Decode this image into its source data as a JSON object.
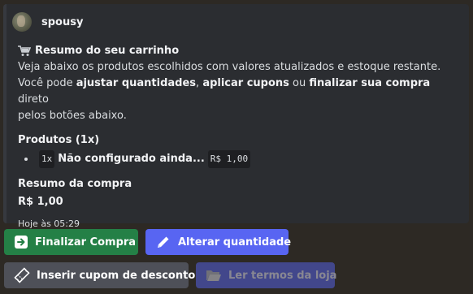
{
  "author": {
    "name": "spousy"
  },
  "embed": {
    "title": "Resumo do seu carrinho",
    "line1": "Veja abaixo os produtos escolhidos com valores atualizados e estoque restante.",
    "line2_pre": "Você pode ",
    "line2_b1": "ajustar quantidades",
    "line2_sep": ", ",
    "line2_b2": "aplicar cupons",
    "line2_mid": " ou ",
    "line2_b3": "finalizar sua compra",
    "line2_post": " direto",
    "line3": "pelos botões abaixo.",
    "products_label": "Produtos (1x)",
    "product": {
      "qty": "1x",
      "name": "Não configurado ainda...",
      "price": "R$ 1,00"
    },
    "summary_label": "Resumo da compra",
    "summary_total": "R$ 1,00",
    "timestamp": "Hoje às 05:29"
  },
  "buttons": {
    "finalize": "Finalizar Compra",
    "change_qty": "Alterar quantidade",
    "coupon": "Inserir cupom de desconto",
    "terms": "Ler termos da loja"
  },
  "colors": {
    "success": "#248046",
    "primary": "#5865f2",
    "secondary": "#4e5058"
  }
}
